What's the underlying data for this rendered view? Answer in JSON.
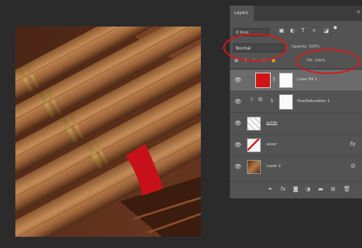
{
  "panel": {
    "tab_label": "Layers",
    "tab_menu_glyph": "≡",
    "kind_label": "Q Kind",
    "blend_mode": "Normal",
    "opacity_label": "Opacity: 100%",
    "fill_label": "Fill: 100%",
    "layers": [
      {
        "name": "Color Fill 1"
      },
      {
        "name": "Hue/Saturation 1"
      },
      {
        "name": "guide"
      },
      {
        "name": "silver"
      },
      {
        "name": "Layer 2"
      }
    ]
  },
  "colors": {
    "panel_bg": "#535353",
    "selected_row": "#6b6b6b",
    "color_fill": "#d11414",
    "highlight": "#e01616",
    "band": "#c8101a"
  }
}
